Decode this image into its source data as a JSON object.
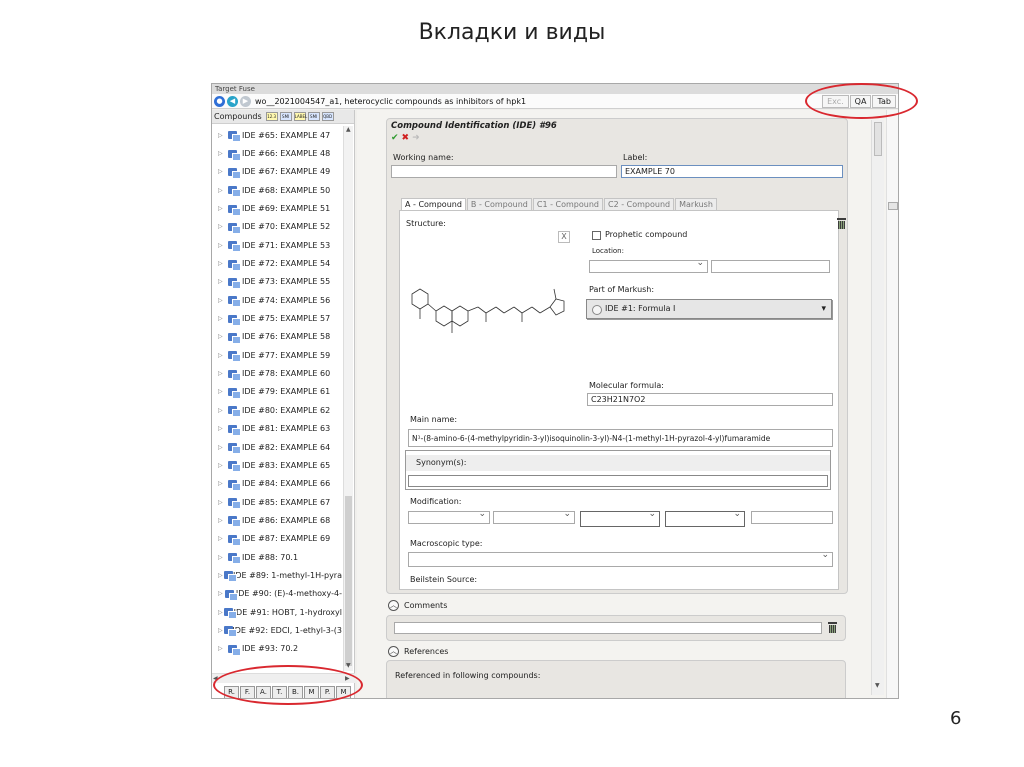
{
  "slide": {
    "title": "Вкладки и виды",
    "page_number": "6"
  },
  "app": {
    "titlebar": "Target Fuse",
    "document_title": "wo__2021004547_a1, heterocyclic compounds as inhibitors of hpk1",
    "view_tabs": [
      "Exc.",
      "QA",
      "Tab"
    ]
  },
  "left_panel": {
    "header": "Compounds",
    "mini_buttons": [
      "12.3",
      "SMI",
      "LABEL",
      "SMI",
      "QBD"
    ],
    "tree_items": [
      "IDE #65: EXAMPLE 47",
      "IDE #66: EXAMPLE 48",
      "IDE #67: EXAMPLE 49",
      "IDE #68: EXAMPLE 50",
      "IDE #69: EXAMPLE 51",
      "IDE #70: EXAMPLE 52",
      "IDE #71: EXAMPLE 53",
      "IDE #72: EXAMPLE 54",
      "IDE #73: EXAMPLE 55",
      "IDE #74: EXAMPLE 56",
      "IDE #75: EXAMPLE 57",
      "IDE #76: EXAMPLE 58",
      "IDE #77: EXAMPLE 59",
      "IDE #78: EXAMPLE 60",
      "IDE #79: EXAMPLE 61",
      "IDE #80: EXAMPLE 62",
      "IDE #81: EXAMPLE 63",
      "IDE #82: EXAMPLE 64",
      "IDE #83: EXAMPLE 65",
      "IDE #84: EXAMPLE 66",
      "IDE #85: EXAMPLE 67",
      "IDE #86: EXAMPLE 68",
      "IDE #87: EXAMPLE 69",
      "IDE #88: 70.1",
      "IDE #89: 1-methyl-1H-pyra",
      "IDE #90: (E)-4-methoxy-4-",
      "IDE #91: HOBT, 1-hydroxyl",
      "IDE #92: EDCI, 1-ethyl-3-(3",
      "IDE #93: 70.2"
    ],
    "bottom_tabs": [
      "R.",
      "F.",
      "A.",
      "T.",
      "B.",
      "M",
      "P.",
      "M"
    ]
  },
  "ide": {
    "title": "Compound Identification (IDE) #96",
    "working_name_label": "Working name:",
    "working_name_value": "",
    "label_label": "Label:",
    "label_value": "EXAMPLE 70",
    "compound_tabs": [
      "A - Compound",
      "B - Compound",
      "C1 - Compound",
      "C2 - Compound",
      "Markush"
    ],
    "structure_label": "Structure:",
    "close_glyph": "X",
    "prophetic_label": "Prophetic compound",
    "location_label": "Location:",
    "markush_label": "Part of Markush:",
    "markush_value": "IDE #1: Formula I",
    "formula_label": "Molecular formula:",
    "formula_value": "C23H21N7O2",
    "main_name_label": "Main name:",
    "main_name_value": "N¹-(8-amino-6-(4-methylpyridin-3-yl)isoquinolin-3-yl)-N4-(1-methyl-1H-pyrazol-4-yl)fumaramide",
    "synonyms_label": "Synonym(s):",
    "modification_label": "Modification:",
    "macroscopic_label": "Macroscopic type:",
    "beilstein_label": "Beilstein Source:"
  },
  "comments": {
    "title": "Comments"
  },
  "references": {
    "title": "References",
    "sub": "Referenced in following compounds:"
  },
  "colors": {
    "annotation": "#d9282f",
    "accent_blue": "#2f6fd6",
    "check_green": "#2e9a2e",
    "cross_red": "#d02020"
  },
  "icons": {
    "nav": [
      "home-icon",
      "back-icon",
      "forward-icon"
    ],
    "actions": [
      "check-icon",
      "cross-icon",
      "arrow-icon"
    ]
  }
}
